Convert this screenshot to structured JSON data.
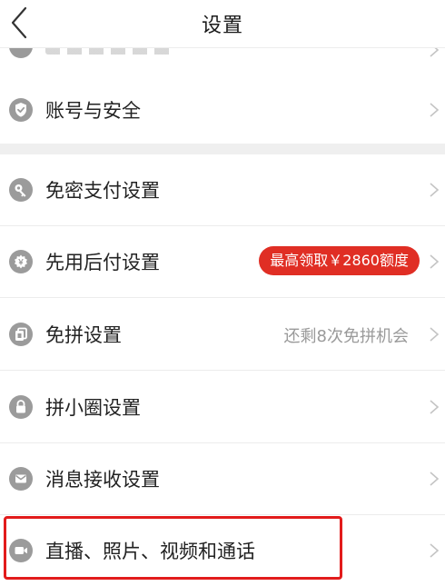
{
  "header": {
    "title": "设置",
    "back_icon": "chevron-left-icon"
  },
  "settings": {
    "account_security": {
      "label": "账号与安全",
      "icon": "shield-check-icon"
    },
    "password_free_pay": {
      "label": "免密支付设置",
      "icon": "key-icon"
    },
    "pay_later": {
      "label": "先用后付设置",
      "icon": "gear-badge-icon",
      "promo": "最高领取￥2860额度",
      "promo_color": "#e02e24"
    },
    "free_group": {
      "label": "免拼设置",
      "icon": "copy-icon",
      "hint": "还剩8次免拼机会"
    },
    "circle": {
      "label": "拼小圈设置",
      "icon": "lock-icon"
    },
    "messages": {
      "label": "消息接收设置",
      "icon": "mail-icon"
    },
    "media_call": {
      "label": "直播、照片、视频和通话",
      "icon": "video-camera-icon"
    }
  },
  "colors": {
    "icon_gray": "#9b9b9b",
    "highlight": "#e21b1b"
  }
}
